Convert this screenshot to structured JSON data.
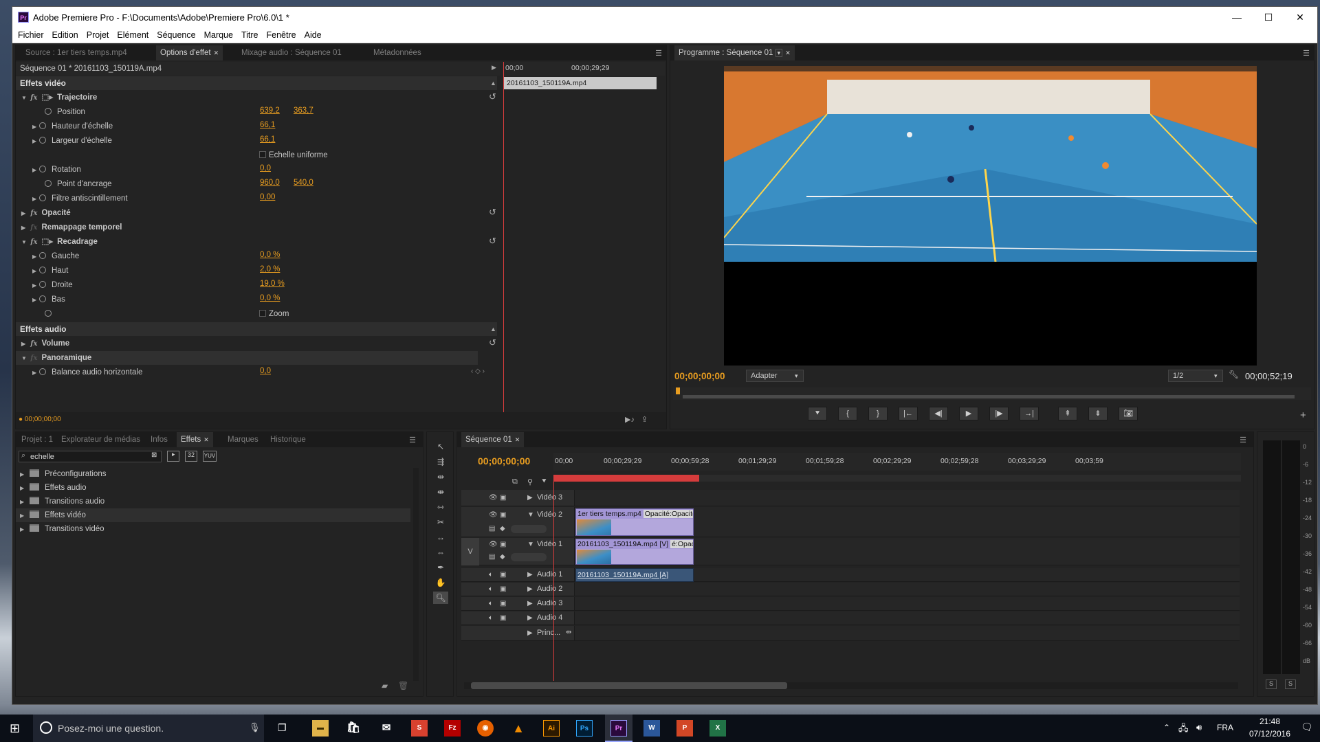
{
  "window": {
    "title": "Adobe Premiere Pro - F:\\Documents\\Adobe\\Premiere Pro\\6.0\\1 *",
    "app_icon": "Pr"
  },
  "menu": [
    "Fichier",
    "Edition",
    "Projet",
    "Elément",
    "Séquence",
    "Marque",
    "Titre",
    "Fenêtre",
    "Aide"
  ],
  "effect_panel": {
    "tabs": [
      "Source : 1er tiers temps.mp4",
      "Options d'effet",
      "Mixage audio : Séquence 01",
      "Métadonnées"
    ],
    "clip_path": "Séquence 01 * 20161103_150119A.mp4",
    "ruler_start": "00;00",
    "ruler_mid": "00;00;29;29",
    "clip_bar_label": "20161103_150119A.mp4",
    "video_header": "Effets vidéo",
    "audio_header": "Effets audio",
    "trajectoire": "Trajectoire",
    "position": {
      "label": "Position",
      "x": "639,2",
      "y": "363,7"
    },
    "hauteur": {
      "label": "Hauteur d'échelle",
      "value": "66,1"
    },
    "largeur": {
      "label": "Largeur d'échelle",
      "value": "66,1"
    },
    "echelle_uniforme": "Echelle uniforme",
    "rotation": {
      "label": "Rotation",
      "value": "0,0"
    },
    "ancrage": {
      "label": "Point d'ancrage",
      "x": "960,0",
      "y": "540,0"
    },
    "antiscint": {
      "label": "Filtre antiscintillement",
      "value": "0,00"
    },
    "opacite": "Opacité",
    "remappage": "Remappage temporel",
    "recadrage": "Recadrage",
    "gauche": {
      "label": "Gauche",
      "value": "0,0 %"
    },
    "haut": {
      "label": "Haut",
      "value": "2,0 %"
    },
    "droite": {
      "label": "Droite",
      "value": "19,0 %"
    },
    "bas": {
      "label": "Bas",
      "value": "0,0 %"
    },
    "zoom": "Zoom",
    "volume": "Volume",
    "panoramique": "Panoramique",
    "balance": {
      "label": "Balance audio horizontale",
      "value": "0,0"
    },
    "timecode": "00;00;00;00"
  },
  "program": {
    "tab": "Programme : Séquence 01",
    "current_time": "00;00;00;00",
    "fit": "Adapter",
    "resolution": "1/2",
    "duration": "00;00;52;19"
  },
  "project": {
    "tabs": [
      "Projet : 1",
      "Explorateur de médias",
      "Infos",
      "Effets",
      "Marques",
      "Historique"
    ],
    "search_value": "echelle",
    "folders": [
      "Préconfigurations",
      "Effets audio",
      "Transitions audio",
      "Effets vidéo",
      "Transitions vidéo"
    ],
    "badges": [
      "32",
      "YUV"
    ]
  },
  "timeline": {
    "tab": "Séquence 01",
    "timecode": "00;00;00;00",
    "ruler": [
      "00;00",
      "00;00;29;29",
      "00;00;59;28",
      "00;01;29;29",
      "00;01;59;28",
      "00;02;29;29",
      "00;02;59;28",
      "00;03;29;29",
      "00;03;59"
    ],
    "tracks": {
      "v3": "Vidéo 3",
      "v2": "Vidéo 2",
      "v1": "Vidéo 1",
      "a1": "Audio 1",
      "a2": "Audio 2",
      "a3": "Audio 3",
      "a4": "Audio 4",
      "master": "Princ..."
    },
    "target_label": "V",
    "clip_v2": "1er tiers temps.mp4",
    "clip_v2_fx": "Opacité:Opacité",
    "clip_v1": "20161103_150119A.mp4 [V]",
    "clip_v1_fx": "é:Opacité",
    "clip_a1": "20161103_150119A.mp4 [A]"
  },
  "meter": {
    "scale": [
      "0",
      "-6",
      "-12",
      "-18",
      "-24",
      "-30",
      "-36",
      "-42",
      "-48",
      "-54",
      "-60",
      "-66",
      "dB"
    ],
    "solo": [
      "S",
      "S"
    ]
  },
  "taskbar": {
    "search": "Posez-moi une question.",
    "lang": "FRA",
    "time": "21:48",
    "date": "07/12/2016"
  }
}
